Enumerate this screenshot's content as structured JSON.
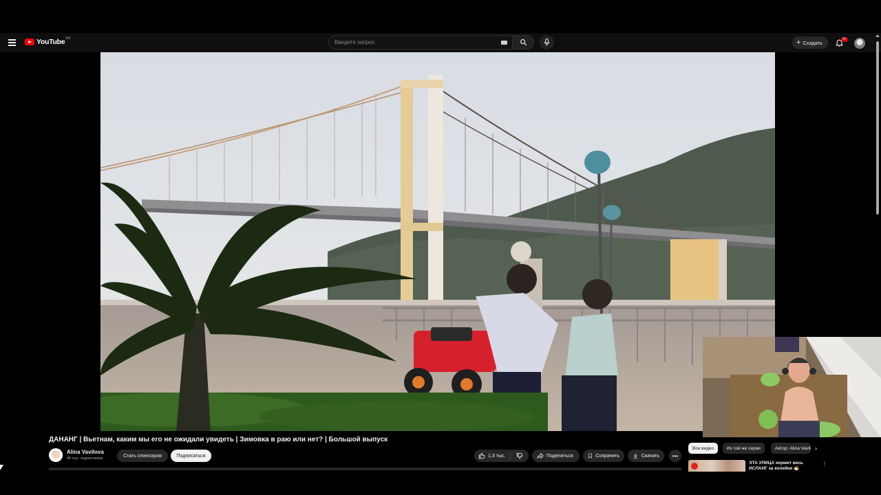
{
  "masthead": {
    "logo_text": "YouTube",
    "region": "RU",
    "search_placeholder": "Введите запрос",
    "create_label": "Создать",
    "notification_count": "9+"
  },
  "video": {
    "title": "ДАНАНГ | Вьетнам, каким мы его не ожидали увидеть | Зимовка в раю или нет? | Большой выпуск",
    "channel_name": "Alina Vavilova",
    "subscribers": "46 тыс. подписчиков",
    "sponsor_label": "Стать спонсором",
    "subscribe_label": "Подписаться",
    "likes": "1,3 тыс.",
    "share_label": "Поделиться",
    "save_label": "Сохранить",
    "download_label": "Скачать"
  },
  "sidebar": {
    "chips": [
      "Все видео",
      "Из той же серии",
      "Автор: Alina Vavilova"
    ],
    "recommendation_title": "ЭТА УЛИЦА кормит весь ИСЛАНГ за копейки 🍜"
  },
  "icons": [
    "menu-icon",
    "youtube-logo-icon",
    "keyboard-icon",
    "search-icon",
    "mic-icon",
    "plus-icon",
    "bell-icon",
    "thumbs-up-icon",
    "thumbs-down-icon",
    "share-icon",
    "save-icon",
    "download-icon",
    "more-icon",
    "chevron-right-icon"
  ],
  "colors": {
    "background": "#0f0f0f",
    "brand_red": "#ff0000",
    "pill": "#272727",
    "text": "#f1f1f1"
  }
}
